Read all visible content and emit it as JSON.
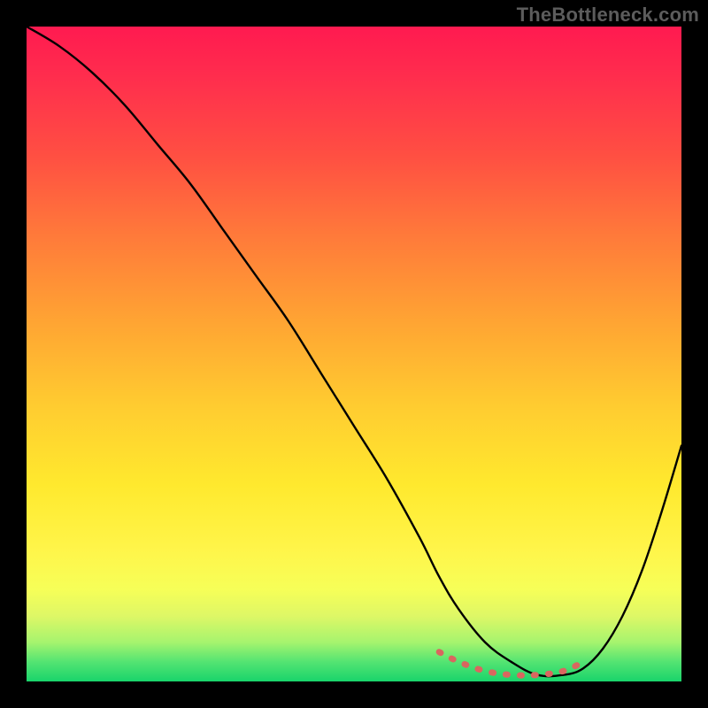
{
  "watermark": "TheBottleneck.com",
  "colors": {
    "main_line": "#000000",
    "dotted_line": "#d9665f",
    "frame_bg": "#000000",
    "gradient_top": "#ff1a50",
    "gradient_bottom": "#19d46b"
  },
  "chart_data": {
    "type": "line",
    "title": "",
    "xlabel": "",
    "ylabel": "",
    "xlim": [
      0,
      100
    ],
    "ylim": [
      0,
      100
    ],
    "grid": false,
    "legend": false,
    "series": [
      {
        "name": "bottleneck-curve",
        "x": [
          0,
          5,
          10,
          15,
          20,
          25,
          30,
          35,
          40,
          45,
          50,
          55,
          60,
          63,
          66,
          70,
          74,
          78,
          82,
          85,
          88,
          91,
          94,
          97,
          100
        ],
        "y": [
          100,
          97,
          93,
          88,
          82,
          76,
          69,
          62,
          55,
          47,
          39,
          31,
          22,
          16,
          11,
          6,
          3,
          1,
          1,
          2,
          5,
          10,
          17,
          26,
          36
        ]
      },
      {
        "name": "optimal-range-dotted",
        "x": [
          63,
          66,
          70,
          74,
          78,
          82,
          85
        ],
        "y": [
          4.5,
          3.0,
          1.6,
          1.0,
          1.0,
          1.6,
          3.0
        ]
      }
    ]
  }
}
